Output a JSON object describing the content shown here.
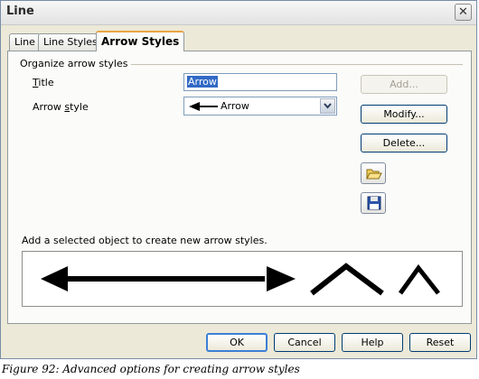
{
  "window": {
    "title": "Line",
    "close_label": "✕"
  },
  "tabs": [
    {
      "label": "Line",
      "active": false
    },
    {
      "label": "Line Styles",
      "active": false
    },
    {
      "label": "Arrow Styles",
      "active": true
    }
  ],
  "group": {
    "label": "Organize arrow styles"
  },
  "fields": {
    "title_label": "Title",
    "title_value": "Arrow",
    "style_label": "Arrow style",
    "style_value": "Arrow"
  },
  "buttons": {
    "add": "Add...",
    "modify": "Modify...",
    "delete": "Delete...",
    "ok": "OK",
    "cancel": "Cancel",
    "help": "Help",
    "reset": "Reset"
  },
  "icons": {
    "open": "folder-open-icon",
    "save": "floppy-disk-icon"
  },
  "hint": "Add a selected object to create new arrow styles.",
  "caption": "Figure 92: Advanced options for creating arrow styles"
}
